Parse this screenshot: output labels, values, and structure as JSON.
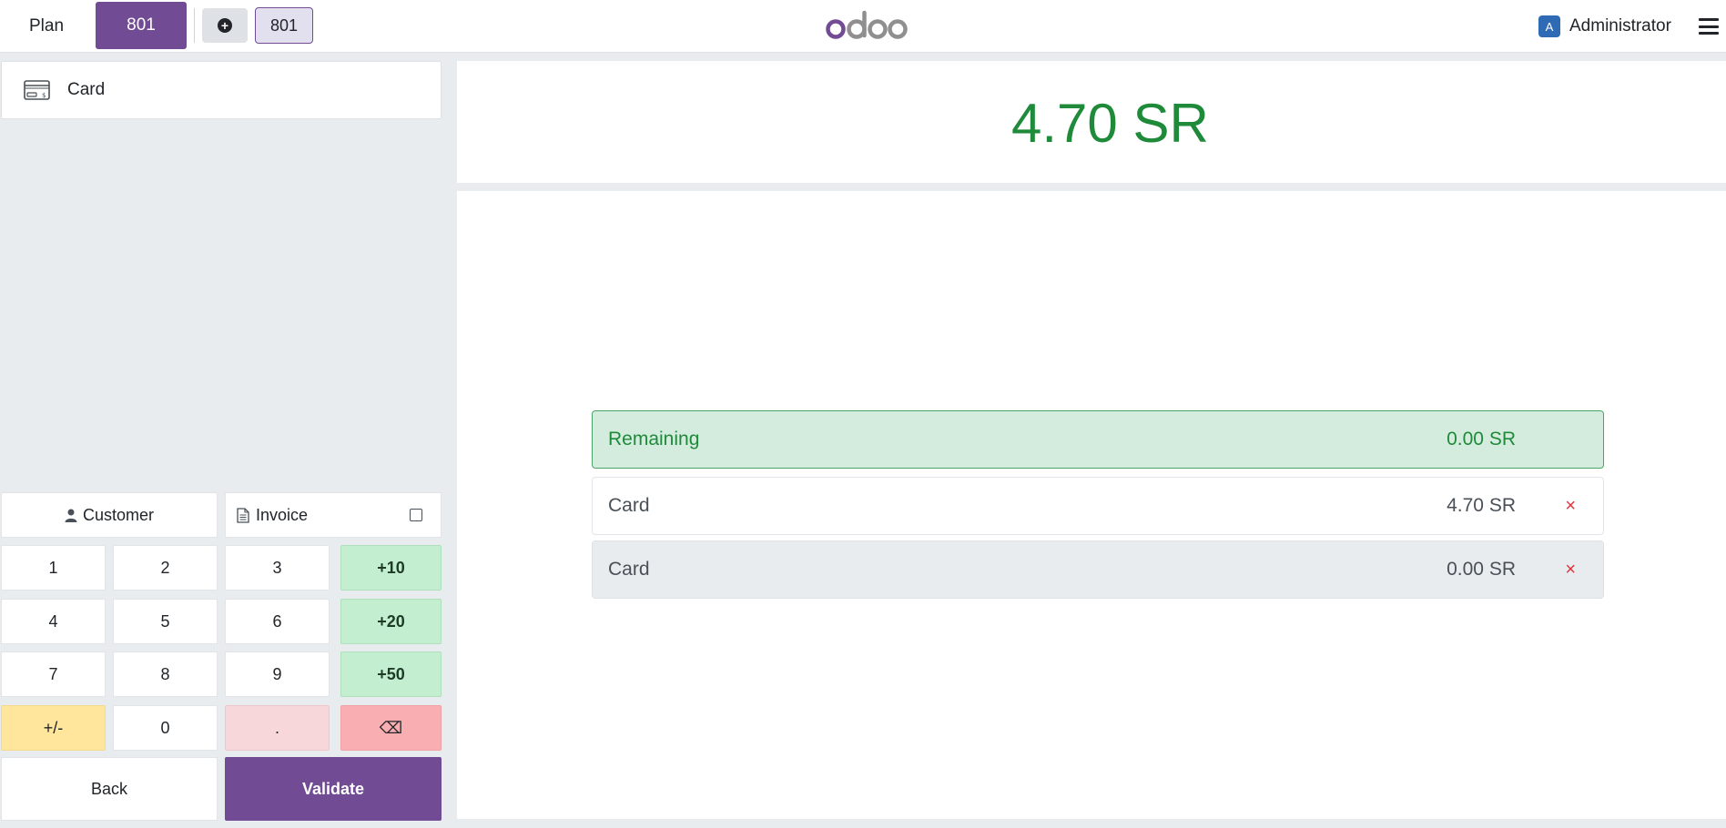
{
  "navbar": {
    "plan_label": "Plan",
    "active_table": "801",
    "order_tab": "801",
    "user_initial": "A",
    "user_name": "Administrator"
  },
  "payment_methods": [
    {
      "label": "Card",
      "icon": "credit-card-icon"
    }
  ],
  "actions": {
    "customer_label": "Customer",
    "invoice_label": "Invoice",
    "invoice_checked": false
  },
  "numpad": {
    "keys": [
      "1",
      "2",
      "3",
      "+10",
      "4",
      "5",
      "6",
      "+20",
      "7",
      "8",
      "9",
      "+50",
      "+/-",
      "0",
      ".",
      "⌫"
    ]
  },
  "footer": {
    "back_label": "Back",
    "validate_label": "Validate"
  },
  "summary": {
    "total": "4.70 SR",
    "remaining_label": "Remaining",
    "remaining_amount": "0.00 SR"
  },
  "payment_lines": [
    {
      "method": "Card",
      "amount": "4.70 SR",
      "delete": "×"
    },
    {
      "method": "Card",
      "amount": "0.00 SR",
      "delete": "×"
    }
  ],
  "colors": {
    "brand_purple": "#714b93",
    "success_green": "#1e8a3a",
    "delete_red": "#d9363e"
  }
}
